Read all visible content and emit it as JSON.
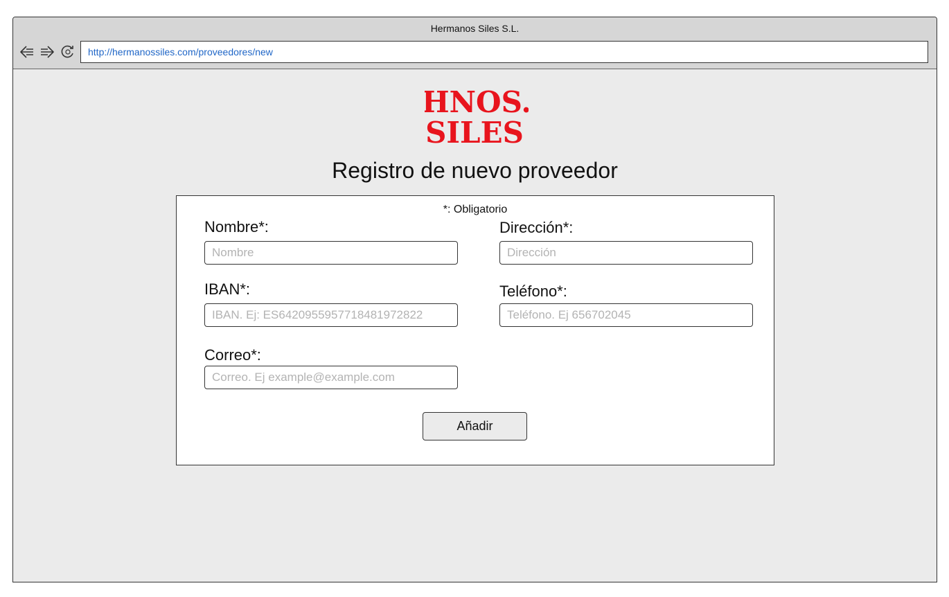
{
  "window": {
    "title": "Hermanos Siles S.L.",
    "url": "http://hermanossiles.com/proveedores/new",
    "nav_icons": [
      "back-arrow-icon",
      "forward-arrow-icon",
      "refresh-icon"
    ]
  },
  "logo": {
    "line1": "HNOS.",
    "line2": "SILES",
    "color": "#e8141d"
  },
  "page": {
    "title": "Registro de nuevo proveedor",
    "required_note": "*: Obligatorio"
  },
  "form": {
    "nombre": {
      "label": "Nombre*:",
      "placeholder": "Nombre",
      "value": ""
    },
    "direccion": {
      "label": "Dirección*:",
      "placeholder": "Dirección",
      "value": ""
    },
    "iban": {
      "label": "IBAN*:",
      "placeholder": "IBAN. Ej: ES6420955957718481972822",
      "value": ""
    },
    "telefono": {
      "label": "Teléfono*:",
      "placeholder": "Teléfono. Ej 656702045",
      "value": ""
    },
    "correo": {
      "label": "Correo*:",
      "placeholder": "Correo. Ej example@example.com",
      "value": ""
    },
    "submit_label": "Añadir"
  },
  "colors": {
    "url_text": "#1f66c7",
    "background": "#ebebeb",
    "titlebar": "#d6d6d6"
  }
}
